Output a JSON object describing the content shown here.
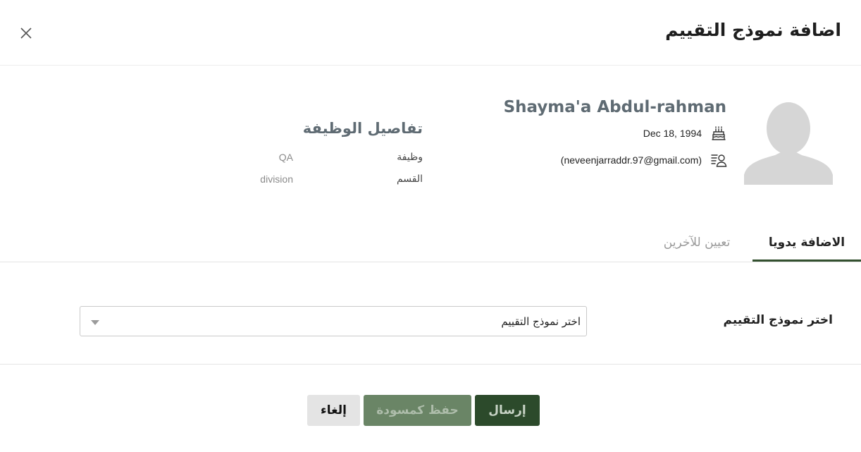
{
  "modal": {
    "title": "اضافة نموذج التقييم"
  },
  "employee": {
    "name": "Shayma'a Abdul-rahman",
    "birth_date": "Dec 18, 1994",
    "email": "(neveenjarraddr.97@gmail.com)",
    "icons": {
      "birth": "birthday-cake-icon",
      "contact": "person-card-icon",
      "avatar": "avatar-placeholder"
    }
  },
  "job_details": {
    "title": "تفاصيل الوظيفة",
    "rows": [
      {
        "label": "وظيفة",
        "value": "QA"
      },
      {
        "label": "القسم",
        "value": "division"
      }
    ]
  },
  "tabs": [
    {
      "label": "الاضافة يدويا",
      "active": true
    },
    {
      "label": "تعيين للآخرين",
      "active": false
    }
  ],
  "form": {
    "label": "اختر نموذج التقييم",
    "select_value": "اختر نموذج التقييم"
  },
  "buttons": {
    "send": "إرسال",
    "save_draft": "حفظ كمسودة",
    "cancel": "إلغاء"
  },
  "colors": {
    "primary": "#2c4a2b",
    "primary_muted": "#6a8566",
    "tab_underline": "#33502f",
    "heading_gray": "#5f6b73"
  }
}
